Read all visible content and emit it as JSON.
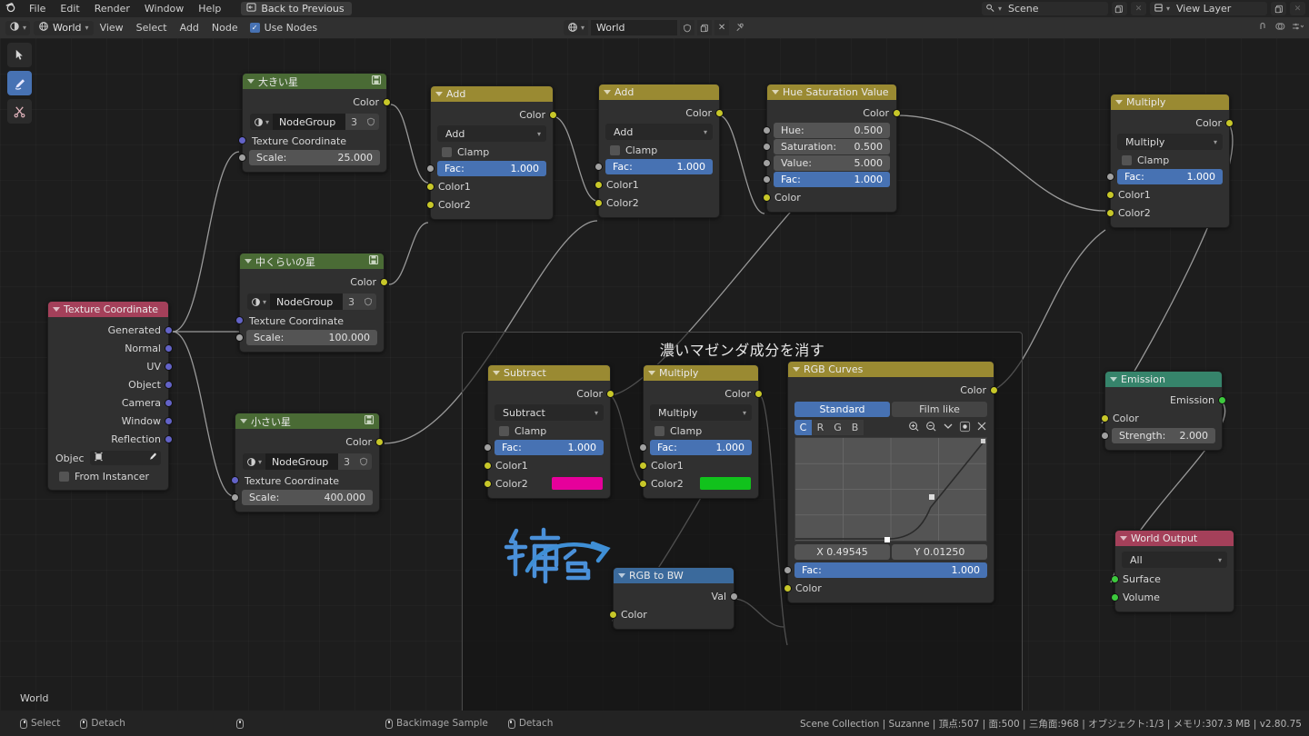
{
  "topbar": {
    "logo": "blender-logo",
    "menus": [
      "File",
      "Edit",
      "Render",
      "Window",
      "Help"
    ],
    "back_button": "Back to Previous",
    "scene_label": "Scene",
    "viewlayer_label": "View Layer"
  },
  "editor_header": {
    "editor_type": "shader-editor-icon",
    "shader_type": "World",
    "menus": [
      "View",
      "Select",
      "Add",
      "Node"
    ],
    "use_nodes_label": "Use Nodes",
    "use_nodes_checked": true,
    "world_datablock": "World"
  },
  "tools": [
    {
      "name": "tweak-tool",
      "icon": "cursor-arrow",
      "active": false
    },
    {
      "name": "annotate-tool",
      "icon": "pencil",
      "active": true
    },
    {
      "name": "links-cut-tool",
      "icon": "scissors",
      "active": false
    }
  ],
  "canvas": {
    "world_label": "World"
  },
  "frame": {
    "title": "濃いマゼンダ成分を消す"
  },
  "annotation": {
    "text": "補色"
  },
  "nodes": {
    "texture_coordinate": {
      "title": "Texture Coordinate",
      "outputs": [
        "Generated",
        "Normal",
        "UV",
        "Object",
        "Camera",
        "Window",
        "Reflection"
      ],
      "object_label": "Objec",
      "from_instancer_label": "From Instancer"
    },
    "big_star": {
      "title": "大きい星",
      "output": "Color",
      "group_name": "NodeGroup",
      "users": "3",
      "input_label": "Texture Coordinate",
      "scale_label": "Scale:",
      "scale_value": "25.000"
    },
    "medium_star": {
      "title": "中くらいの星",
      "output": "Color",
      "group_name": "NodeGroup",
      "users": "3",
      "input_label": "Texture Coordinate",
      "scale_label": "Scale:",
      "scale_value": "100.000"
    },
    "small_star": {
      "title": "小さい星",
      "output": "Color",
      "group_name": "NodeGroup",
      "users": "3",
      "input_label": "Texture Coordinate",
      "scale_label": "Scale:",
      "scale_value": "400.000"
    },
    "add1": {
      "title": "Add",
      "output": "Color",
      "blend_mode": "Add",
      "clamp_label": "Clamp",
      "clamp_checked": false,
      "fac_label": "Fac:",
      "fac_value": "1.000",
      "color1_label": "Color1",
      "color2_label": "Color2"
    },
    "add2": {
      "title": "Add",
      "output": "Color",
      "blend_mode": "Add",
      "clamp_label": "Clamp",
      "clamp_checked": false,
      "fac_label": "Fac:",
      "fac_value": "1.000",
      "color1_label": "Color1",
      "color2_label": "Color2"
    },
    "hsv": {
      "title": "Hue Saturation Value",
      "output": "Color",
      "hue_label": "Hue:",
      "hue_value": "0.500",
      "saturation_label": "Saturation:",
      "saturation_value": "0.500",
      "value_label": "Value:",
      "value_value": "5.000",
      "fac_label": "Fac:",
      "fac_value": "1.000",
      "color_label": "Color"
    },
    "multiply_right": {
      "title": "Multiply",
      "output": "Color",
      "blend_mode": "Multiply",
      "clamp_label": "Clamp",
      "clamp_checked": false,
      "fac_label": "Fac:",
      "fac_value": "1.000",
      "color1_label": "Color1",
      "color2_label": "Color2"
    },
    "subtract": {
      "title": "Subtract",
      "output": "Color",
      "blend_mode": "Subtract",
      "clamp_label": "Clamp",
      "clamp_checked": false,
      "fac_label": "Fac:",
      "fac_value": "1.000",
      "color1_label": "Color1",
      "color2_label": "Color2",
      "color2_swatch": "#e6009b"
    },
    "multiply_frame": {
      "title": "Multiply",
      "output": "Color",
      "blend_mode": "Multiply",
      "clamp_label": "Clamp",
      "clamp_checked": false,
      "fac_label": "Fac:",
      "fac_value": "1.000",
      "color1_label": "Color1",
      "color2_label": "Color2",
      "color2_swatch": "#11c21c"
    },
    "rgb_curves": {
      "title": "RGB Curves",
      "output": "Color",
      "preset_standard": "Standard",
      "preset_filmlike": "Film like",
      "channels": [
        "C",
        "R",
        "G",
        "B"
      ],
      "selected_channel": "C",
      "x_label": "X 0.49545",
      "y_label": "Y 0.01250",
      "fac_label": "Fac:",
      "fac_value": "1.000",
      "color_label": "Color"
    },
    "rgb_to_bw": {
      "title": "RGB to BW",
      "output": "Val",
      "input": "Color"
    },
    "emission": {
      "title": "Emission",
      "output": "Emission",
      "color_label": "Color",
      "strength_label": "Strength:",
      "strength_value": "2.000"
    },
    "world_output": {
      "title": "World Output",
      "target": "All",
      "surface_label": "Surface",
      "volume_label": "Volume"
    }
  },
  "statusbar": {
    "left": [
      {
        "icon": "mouse-left",
        "label": "Select"
      },
      {
        "icon": "mouse-right",
        "label": "Detach"
      },
      {
        "icon": "mouse-middle",
        "label": ""
      }
    ],
    "mid": [
      {
        "icon": "mouse-left",
        "label": "Backimage Sample"
      },
      {
        "icon": "mouse-right",
        "label": "Detach"
      }
    ],
    "info": "Scene Collection | Suzanne | 頂点:507 | 面:500 | 三角面:968 | オブジェクト:1/3 | メモリ:307.3 MB | v2.80.75"
  }
}
